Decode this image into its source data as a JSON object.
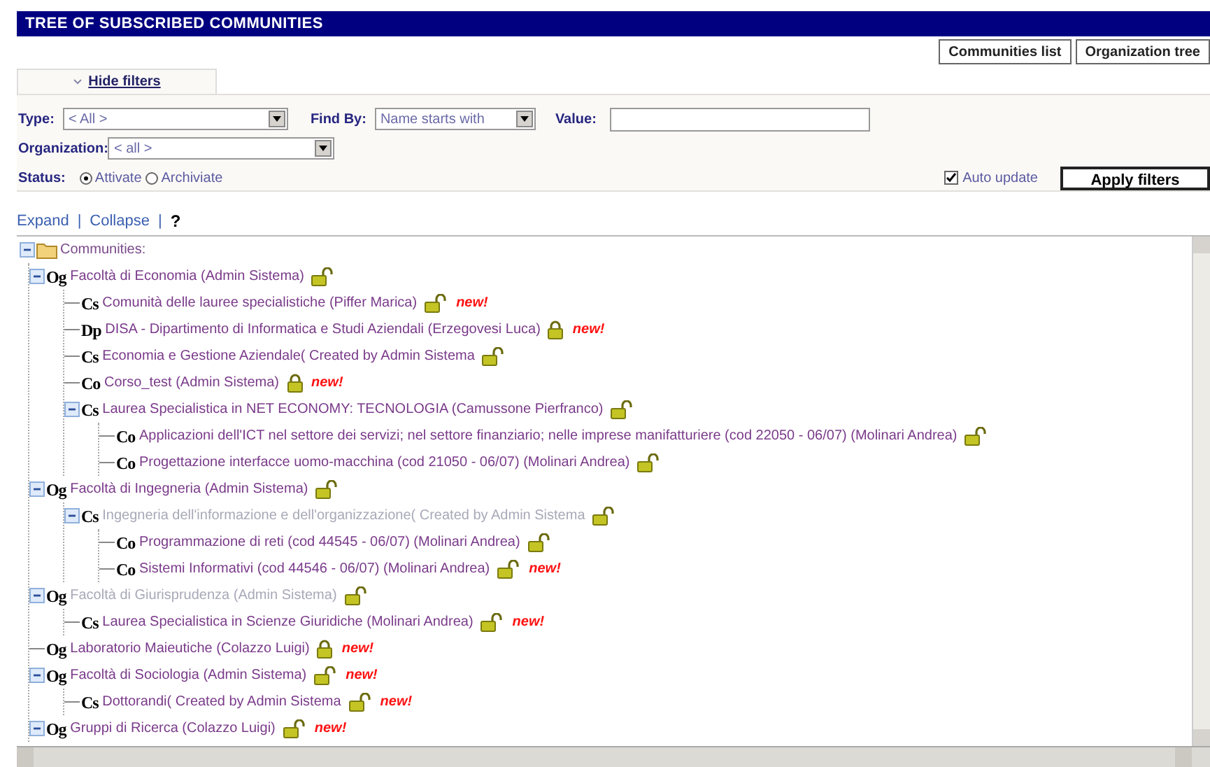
{
  "title": "TREE OF SUBSCRIBED COMMUNITIES",
  "view_buttons": [
    {
      "label": "Communities list"
    },
    {
      "label": "Organization tree"
    }
  ],
  "filter_tab": {
    "label": "Hide filters"
  },
  "filters": {
    "type_label": "Type:",
    "type_value": "< All >",
    "find_by_label": "Find By:",
    "find_by_value": "Name starts with",
    "value_label": "Value:",
    "organization_label": "Organization:",
    "organization_value": "< all >",
    "status_label": "Status:",
    "status_options": [
      {
        "label": "Attivate",
        "selected": true
      },
      {
        "label": "Archiviate",
        "selected": false
      }
    ],
    "auto_update": {
      "label": "Auto update",
      "checked": true
    },
    "apply_button": "Apply filters"
  },
  "tree_links": [
    {
      "label": "Expand",
      "kind": "link"
    },
    {
      "label": "|",
      "kind": "separator"
    },
    {
      "label": "Collapse",
      "kind": "link"
    },
    {
      "label": "|",
      "kind": "separator"
    },
    {
      "label": "?",
      "kind": "help"
    }
  ],
  "tree": {
    "label": "Communities:",
    "expanded": true,
    "children": [
      {
        "badge": "Og",
        "label": "Facoltà di Economia (Admin Sistema)",
        "locked": false,
        "disabled": false,
        "expanded": true,
        "children": [
          {
            "badge": "Cs",
            "label": "Comunità delle lauree specialistiche (Piffer Marica)",
            "locked": false,
            "disabled": false,
            "tag": "new!"
          },
          {
            "badge": "Dp",
            "label": "DISA - Dipartimento di Informatica e Studi Aziendali (Erzegovesi Luca)",
            "locked": true,
            "disabled": false,
            "tag": "new!"
          },
          {
            "badge": "Cs",
            "label": "Economia e Gestione Aziendale( Created by Admin Sistema",
            "locked": false,
            "disabled": false
          },
          {
            "badge": "Co",
            "label": "Corso_test (Admin Sistema)",
            "locked": true,
            "disabled": false,
            "tag": "new!"
          },
          {
            "badge": "Cs",
            "label": "Laurea Specialistica in NET ECONOMY: TECNOLOGIA (Camussone Pierfranco)",
            "locked": false,
            "disabled": false,
            "expanded": true,
            "children": [
              {
                "badge": "Co",
                "label": "Applicazioni dell'ICT nel settore dei servizi; nel settore finanziario; nelle imprese manifatturiere (cod 22050 - 06/07) (Molinari Andrea)",
                "locked": false,
                "disabled": false
              },
              {
                "badge": "Co",
                "label": "Progettazione interfacce uomo-macchina (cod 21050 - 06/07) (Molinari Andrea)",
                "locked": false,
                "disabled": false
              }
            ]
          }
        ]
      },
      {
        "badge": "Og",
        "label": "Facoltà di Ingegneria (Admin Sistema)",
        "locked": false,
        "disabled": false,
        "expanded": true,
        "children": [
          {
            "badge": "Cs",
            "label": "Ingegneria dell'informazione e dell'organizzazione( Created by Admin Sistema",
            "locked": false,
            "disabled": true,
            "expanded": true,
            "children": [
              {
                "badge": "Co",
                "label": "Programmazione di reti (cod 44545 - 06/07) (Molinari Andrea)",
                "locked": false,
                "disabled": false
              },
              {
                "badge": "Co",
                "label": "Sistemi Informativi (cod 44546 - 06/07) (Molinari Andrea)",
                "locked": false,
                "disabled": false,
                "tag": "new!"
              }
            ]
          }
        ]
      },
      {
        "badge": "Og",
        "label": "Facoltà di Giurisprudenza (Admin Sistema)",
        "locked": false,
        "disabled": true,
        "expanded": true,
        "children": [
          {
            "badge": "Cs",
            "label": "Laurea Specialistica in Scienze Giuridiche (Molinari Andrea)",
            "locked": false,
            "disabled": false,
            "tag": "new!"
          }
        ]
      },
      {
        "badge": "Og",
        "label": "Laboratorio Maieutiche (Colazzo Luigi)",
        "locked": true,
        "disabled": false,
        "tag": "new!"
      },
      {
        "badge": "Og",
        "label": "Facoltà di Sociologia (Admin Sistema)",
        "locked": false,
        "disabled": false,
        "tag": "new!",
        "expanded": true,
        "children": [
          {
            "badge": "Cs",
            "label": "Dottorandi( Created by Admin Sistema",
            "locked": false,
            "disabled": false,
            "tag": "new!"
          }
        ]
      },
      {
        "badge": "Og",
        "label": "Gruppi di Ricerca (Colazzo Luigi)",
        "locked": false,
        "disabled": false,
        "tag": "new!",
        "expanded": true
      }
    ]
  }
}
